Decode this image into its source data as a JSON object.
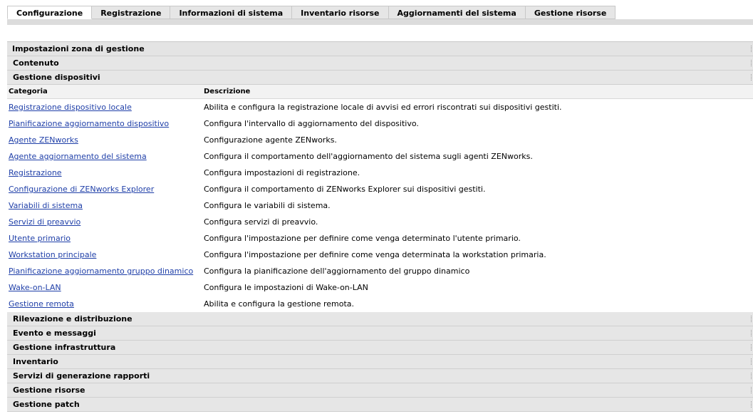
{
  "tabs": [
    {
      "label": "Configurazione",
      "active": true
    },
    {
      "label": "Registrazione",
      "active": false
    },
    {
      "label": "Informazioni di sistema",
      "active": false
    },
    {
      "label": "Inventario risorse",
      "active": false
    },
    {
      "label": "Aggiornamenti del sistema",
      "active": false
    },
    {
      "label": "Gestione risorse",
      "active": false
    }
  ],
  "panel": {
    "title": "Impostazioni zona di gestione",
    "sections_before": [
      "Contenuto"
    ],
    "expanded_section": "Gestione dispositivi",
    "columns": {
      "category": "Categoria",
      "description": "Descrizione"
    },
    "rows": [
      {
        "category": "Registrazione dispositivo locale",
        "description": "Abilita e configura la registrazione locale di avvisi ed errori riscontrati sui dispositivi gestiti."
      },
      {
        "category": "Pianificazione aggiornamento dispositivo",
        "description": "Configura l'intervallo di aggiornamento del dispositivo."
      },
      {
        "category": "Agente ZENworks",
        "description": "Configurazione agente ZENworks."
      },
      {
        "category": "Agente aggiornamento del sistema",
        "description": "Configura il comportamento dell'aggiornamento del sistema sugli agenti ZENworks."
      },
      {
        "category": "Registrazione",
        "description": "Configura impostazioni di registrazione."
      },
      {
        "category": "Configurazione di ZENworks Explorer",
        "description": "Configura il comportamento di ZENworks Explorer sui dispositivi gestiti."
      },
      {
        "category": "Variabili di sistema",
        "description": "Configura le variabili di sistema."
      },
      {
        "category": "Servizi di preavvio",
        "description": "Configura servizi di preavvio."
      },
      {
        "category": "Utente primario",
        "description": "Configura l'impostazione per definire come venga determinato l'utente primario."
      },
      {
        "category": "Workstation principale",
        "description": "Configura l'impostazione per definire come venga determinata la workstation primaria."
      },
      {
        "category": "Pianificazione aggiornamento gruppo dinamico",
        "description": "Configura la pianificazione dell'aggiornamento del gruppo dinamico"
      },
      {
        "category": "Wake-on-LAN",
        "description": "Configura le impostazioni di Wake-on-LAN"
      },
      {
        "category": "Gestione remota",
        "description": "Abilita e configura la gestione remota."
      }
    ],
    "sections_after": [
      "Rilevazione e distribuzione",
      "Evento e messaggi",
      "Gestione infrastruttura",
      "Inventario",
      "Servizi di generazione rapporti",
      "Gestione risorse",
      "Gestione patch"
    ]
  }
}
